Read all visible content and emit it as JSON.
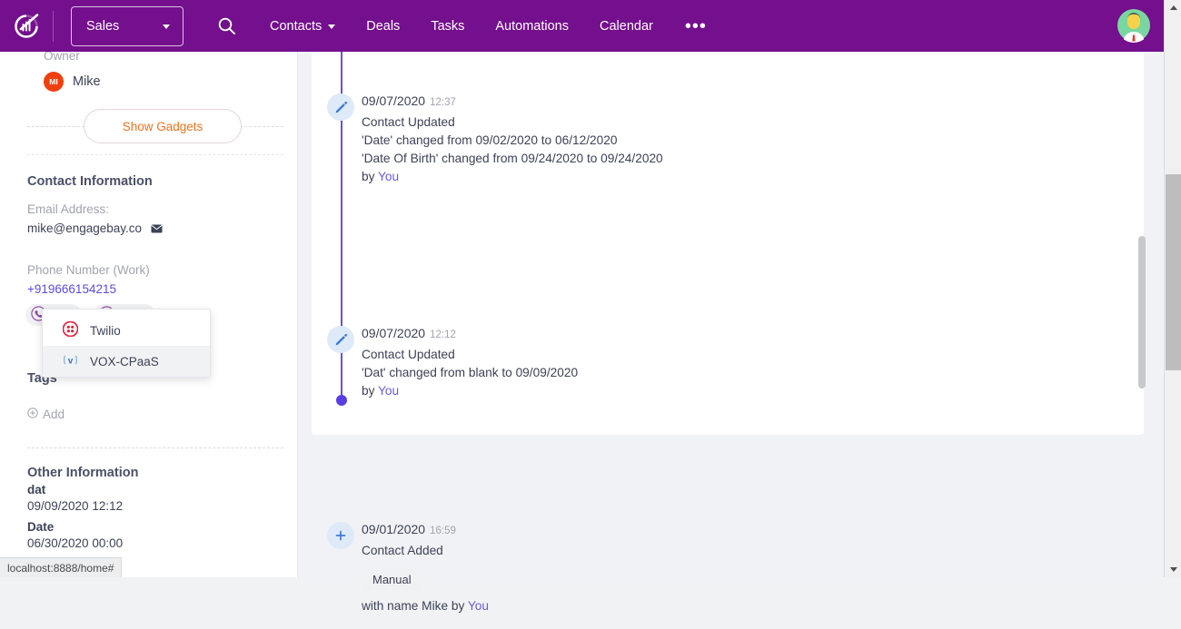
{
  "browser": {
    "status_url": "localhost:8888/home#"
  },
  "topnav": {
    "logo": "engagebay-logo",
    "workspace_selector": {
      "label": "Sales",
      "icon": "chevron-down-icon"
    },
    "search_icon": "search-icon",
    "links": [
      {
        "label": "Contacts",
        "has_caret": true
      },
      {
        "label": "Deals",
        "has_caret": false
      },
      {
        "label": "Tasks",
        "has_caret": false
      },
      {
        "label": "Automations",
        "has_caret": false
      },
      {
        "label": "Calendar",
        "has_caret": false
      }
    ],
    "more_label": "•••",
    "avatar": "user-avatar",
    "background_color": "#740f8d"
  },
  "left_panel": {
    "owner": {
      "label": "Owner",
      "initials": "MI",
      "name": "Mike",
      "badge_color": "#f03f0e"
    },
    "show_gadgets_label": "Show Gadgets",
    "contact_information": {
      "title": "Contact Information",
      "email_label": "Email Address:",
      "email_value": "mike@engagebay.co",
      "email_icon": "envelope-icon",
      "phone_label": "Phone Number (Work)",
      "phone_value": "+919666154215",
      "actions": [
        {
          "label": "Call",
          "icon": "phone-icon"
        },
        {
          "label": "SMS",
          "icon": "sms-icon"
        }
      ]
    },
    "sms_provider_dropdown": {
      "options": [
        {
          "label": "Twilio",
          "icon": "twilio-icon",
          "hovered": false
        },
        {
          "label": "VOX-CPaaS",
          "icon": "vox-cpaas-icon",
          "hovered": true
        }
      ]
    },
    "tags": {
      "title": "Tags",
      "add_label": "Add",
      "add_icon": "plus-circle-icon"
    },
    "other_information": {
      "title": "Other Information",
      "fields": [
        {
          "label": "dat",
          "value": "09/09/2020 12:12"
        },
        {
          "label": "Date",
          "value": "06/30/2020 00:00"
        }
      ]
    }
  },
  "timeline": {
    "entries": [
      {
        "icon": "pencil-icon",
        "date": "09/07/2020",
        "time": "12:37",
        "title": "Contact Updated",
        "lines": [
          "'Date' changed from 09/02/2020 to 06/12/2020",
          "'Date Of Birth' changed from 09/24/2020 to 09/24/2020"
        ],
        "by_prefix": "by ",
        "by_actor": "You",
        "tag": null,
        "footer": null
      },
      {
        "icon": "pencil-icon",
        "date": "09/07/2020",
        "time": "12:12",
        "title": "Contact Updated",
        "lines": [
          "'Dat' changed from blank to 09/09/2020"
        ],
        "by_prefix": "by ",
        "by_actor": "You",
        "tag": null,
        "footer": null
      },
      {
        "icon": "plus-icon",
        "date": "09/01/2020",
        "time": "16:59",
        "title": "Contact Added",
        "lines": [],
        "by_prefix": "with name Mike by ",
        "by_actor": "You",
        "tag": "Manual",
        "footer": null
      }
    ],
    "line_color": "#6c4ce0"
  }
}
